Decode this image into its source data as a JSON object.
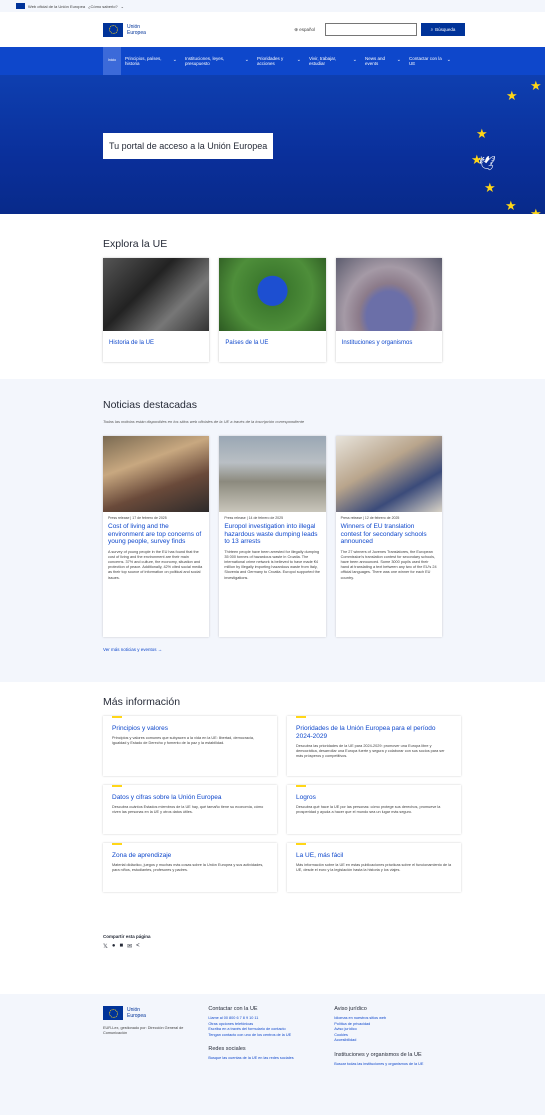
{
  "topbar": {
    "text": "Web oficial de la Unión Europea",
    "link": "¿Cómo saberlo?"
  },
  "header": {
    "logo_line1": "Unión",
    "logo_line2": "Europea",
    "language": "español",
    "search_placeholder": "",
    "search_button": "Búsqueda"
  },
  "nav": {
    "home": "Inicio",
    "items": [
      {
        "label": "Principios, países, historia"
      },
      {
        "label": "Instituciones, leyes, presupuesto"
      },
      {
        "label": "Prioridades y acciones"
      },
      {
        "label": "Vivir, trabajar, estudiar"
      },
      {
        "label": "News and events"
      },
      {
        "label": "Contactar con la UE"
      }
    ]
  },
  "hero": {
    "title": "Tu portal de acceso a la Unión Europea"
  },
  "explore": {
    "title": "Explora la UE",
    "cards": [
      {
        "label": "Historia de la UE"
      },
      {
        "label": "Países de la UE"
      },
      {
        "label": "Instituciones y organismos"
      }
    ]
  },
  "news": {
    "title": "Noticias destacadas",
    "subtitle": "Todas las noticias están disponibles en los sitios web oficiales de la UE a través de la inscripción correspondiente",
    "cards": [
      {
        "meta": "Press release | 17 de febrero de 2025",
        "title": "Cost of living and the environment are top concerns of young people, survey finds",
        "text": "A survey of young people in the EU has found that the cost of living and the environment are their main concerns. 37% and culture, the economy, situation and protection of peace. Additionally, 42% cited social media as their top source of information on political and social issues."
      },
      {
        "meta": "Press release | 14 de febrero de 2025",
        "title": "Europol investigation into illegal hazardous waste dumping leads to 13 arrests",
        "text": "Thirteen people have been arrested for illegally dumping 35 000 tonnes of hazardous waste in Croatia. The international crime network is believed to have made €4 million by illegally importing hazardous waste from Italy, Slovenia and Germany to Croatia. Europol supported the investigations."
      },
      {
        "meta": "Press release | 12 de febrero de 2025",
        "title": "Winners of EU translation contest for secondary schools announced",
        "text": "The 27 winners of Juvenes Translatores, the European Commission's translation contest for secondary schools, have been announced. Some 3000 pupils used their hand at translating a text between any two of the EU's 24 official languages. There was one winner for each EU country."
      }
    ],
    "more": "Ver más noticias y eventos"
  },
  "info": {
    "title": "Más información",
    "cards": [
      {
        "title": "Principios y valores",
        "text": "Principios y valores comunes que subyacen a la vida en la UE: libertad, democracia, igualdad y Estado de Derecho y fomento de la paz y la estabilidad."
      },
      {
        "title": "Prioridades de la Unión Europea para el período 2024-2029",
        "text": "Descubra las prioridades de la UE para 2024-2029: promover una Europa libre y democrática, desarrollar una Europa fuerte y segura y colaborar con sus socios para ser más prósperos y competitivos."
      },
      {
        "title": "Datos y cifras sobre la Unión Europea",
        "text": "Descubra cuántos Estados miembros de la UE hay, qué tamaño tiene su economía, cómo viven las personas en la UE y otros datos útiles."
      },
      {
        "title": "Logros",
        "text": "Descubra qué hace la UE por las personas: cómo protege sus derechos, promueve la prosperidad y ayuda a hacer que el mundo sea un lugar más seguro."
      },
      {
        "title": "Zona de aprendizaje",
        "text": "Material didáctico, juegos y muchas más cosas sobre la Unión Europea y sus actividades, para niños, estudiantes, profesores y padres."
      },
      {
        "title": "La UE, más fácil",
        "text": "Más información sobre la UE en estas publicaciones prácticas sobre el funcionamiento de la UE, desde el euro y la legislación hasta la historia y los viajes."
      }
    ]
  },
  "share": {
    "title": "Compartir esta página"
  },
  "footer": {
    "logo_line1": "Unión",
    "logo_line2": "Europea",
    "about": "EUR-Lex, gestionado por: Dirección General de Comunicación",
    "contact_head": "Contactar con la UE",
    "contact_links": [
      "Llame al 00 800 6 7 8 9 10 11",
      "Otras opciones telefónicas",
      "Escriba en a través del formulario de contacto",
      "Tengan contacto con uno de los centros de la UE"
    ],
    "social_head": "Redes sociales",
    "social_links": [
      "Busque las cuentas de la UE en las redes sociales"
    ],
    "legal_head": "Aviso jurídico",
    "legal_links": [
      "Idiomas en nuestros sitios web",
      "Política de privacidad",
      "Aviso jurídico",
      "Cookies",
      "Accesibilidad"
    ],
    "inst_head": "Instituciones y organismos de la UE",
    "inst_links": [
      "Buscar todas las instituciones y organismos de la UE"
    ]
  },
  "colors": {
    "brand": "#003399",
    "nav": "#0e47cb",
    "link": "#0e47cb",
    "star": "#ffd617",
    "light_bg": "#f3f6fc"
  }
}
